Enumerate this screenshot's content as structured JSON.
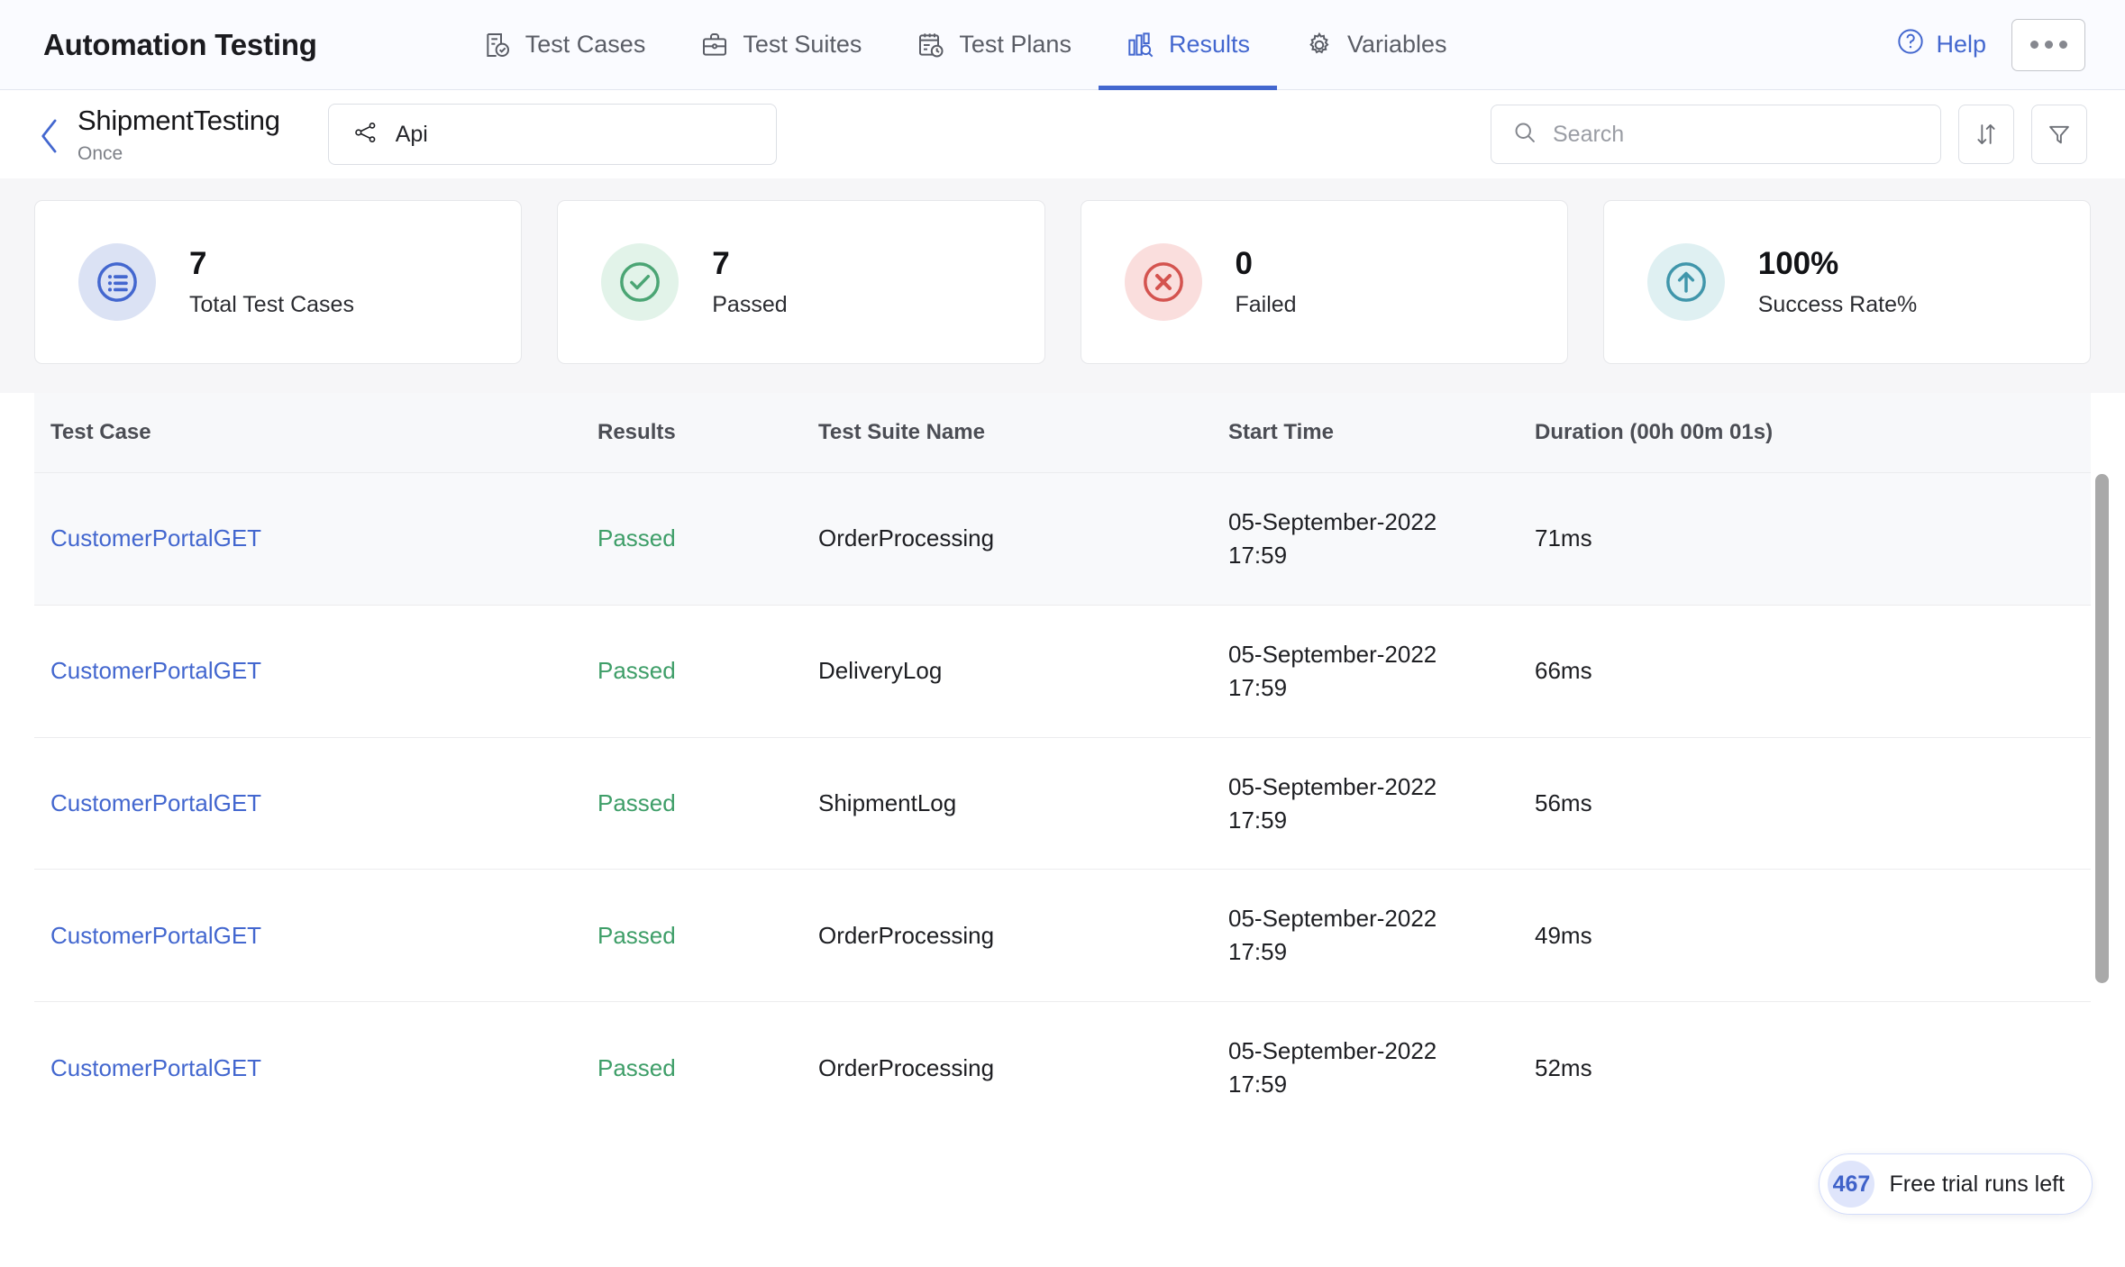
{
  "app": {
    "title": "Automation Testing"
  },
  "nav": {
    "tabs": [
      {
        "label": "Test Cases",
        "icon": "test-cases-icon",
        "active": false
      },
      {
        "label": "Test Suites",
        "icon": "test-suites-icon",
        "active": false
      },
      {
        "label": "Test Plans",
        "icon": "test-plans-icon",
        "active": false
      },
      {
        "label": "Results",
        "icon": "results-icon",
        "active": true
      },
      {
        "label": "Variables",
        "icon": "gear-icon",
        "active": false
      }
    ],
    "help_label": "Help",
    "help_icon": "question-circle-icon",
    "more_icon": "ellipsis-icon",
    "active_color": "#4367cf"
  },
  "subheader": {
    "back_icon": "chevron-left-icon",
    "title": "ShipmentTesting",
    "subtitle": "Once",
    "api_select": {
      "label": "Api",
      "icon": "share-nodes-icon"
    },
    "search": {
      "placeholder": "Search",
      "value": "",
      "icon": "search-icon"
    },
    "sort_icon": "sort-arrows-icon",
    "filter_icon": "funnel-icon"
  },
  "stats": [
    {
      "value": "7",
      "label": "Total Test Cases",
      "icon": "list-circle-icon",
      "color": "#4367cf",
      "bg": "#dbe2f4"
    },
    {
      "value": "7",
      "label": "Passed",
      "icon": "check-circle-icon",
      "color": "#4ba574",
      "bg": "#e2f3e9"
    },
    {
      "value": "0",
      "label": "Failed",
      "icon": "x-circle-icon",
      "color": "#d4534f",
      "bg": "#fadedd"
    },
    {
      "value": "100%",
      "label": "Success Rate%",
      "icon": "arrow-up-circle-icon",
      "color": "#4096ab",
      "bg": "#dff0f2"
    }
  ],
  "table": {
    "columns": [
      "Test Case",
      "Results",
      "Test Suite Name",
      "Start Time",
      "Duration (00h 00m 01s)"
    ],
    "rows": [
      {
        "test_case": "CustomerPortalGET",
        "result": "Passed",
        "suite": "OrderProcessing",
        "date": "05-September-2022",
        "time": "17:59",
        "duration": "71ms",
        "highlight": true
      },
      {
        "test_case": "CustomerPortalGET",
        "result": "Passed",
        "suite": "DeliveryLog",
        "date": "05-September-2022",
        "time": "17:59",
        "duration": "66ms",
        "highlight": false
      },
      {
        "test_case": "CustomerPortalGET",
        "result": "Passed",
        "suite": "ShipmentLog",
        "date": "05-September-2022",
        "time": "17:59",
        "duration": "56ms",
        "highlight": false
      },
      {
        "test_case": "CustomerPortalGET",
        "result": "Passed",
        "suite": "OrderProcessing",
        "date": "05-September-2022",
        "time": "17:59",
        "duration": "49ms",
        "highlight": false
      },
      {
        "test_case": "CustomerPortalGET",
        "result": "Passed",
        "suite": "OrderProcessing",
        "date": "05-September-2022",
        "time": "17:59",
        "duration": "52ms",
        "highlight": false
      }
    ],
    "result_pass_color": "#3e9e68",
    "link_color": "#4367cf"
  },
  "trial": {
    "count": "467",
    "text": "Free trial runs left"
  }
}
